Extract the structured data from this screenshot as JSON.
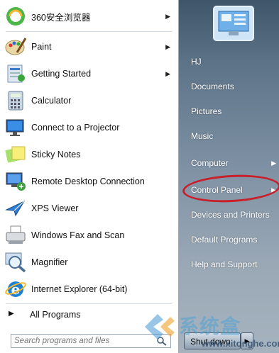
{
  "programs": [
    {
      "label": "360安全浏览器",
      "icon": "360-browser-icon",
      "has_arrow": true
    },
    {
      "label": "Paint",
      "icon": "paint-palette-icon",
      "has_arrow": true
    },
    {
      "label": "Getting Started",
      "icon": "getting-started-icon",
      "has_arrow": true
    },
    {
      "label": "Calculator",
      "icon": "calculator-icon",
      "has_arrow": false
    },
    {
      "label": "Connect to a Projector",
      "icon": "projector-icon",
      "has_arrow": false
    },
    {
      "label": "Sticky Notes",
      "icon": "sticky-notes-icon",
      "has_arrow": false
    },
    {
      "label": "Remote Desktop Connection",
      "icon": "remote-desktop-icon",
      "has_arrow": false
    },
    {
      "label": "XPS Viewer",
      "icon": "xps-viewer-icon",
      "has_arrow": false
    },
    {
      "label": "Windows Fax and Scan",
      "icon": "fax-scan-icon",
      "has_arrow": false
    },
    {
      "label": "Magnifier",
      "icon": "magnifier-icon",
      "has_arrow": false
    },
    {
      "label": "Internet Explorer (64-bit)",
      "icon": "internet-explorer-icon",
      "has_arrow": false
    }
  ],
  "all_programs": {
    "label": "All Programs"
  },
  "search": {
    "placeholder": "Search programs and files"
  },
  "right_items": [
    {
      "label": "HJ",
      "has_arrow": false
    },
    {
      "label": "Documents",
      "has_arrow": false
    },
    {
      "label": "Pictures",
      "has_arrow": false
    },
    {
      "label": "Music",
      "has_arrow": false
    },
    {
      "label": "Computer",
      "has_arrow": true
    },
    {
      "label": "Control Panel",
      "has_arrow": true
    },
    {
      "label": "Devices and Printers",
      "has_arrow": false
    },
    {
      "label": "Default Programs",
      "has_arrow": false
    },
    {
      "label": "Help and Support",
      "has_arrow": false
    }
  ],
  "shutdown": {
    "label": "Shut down"
  },
  "watermark": {
    "chinese": "系统盒",
    "url": "www.xitonghe.com"
  },
  "colors": {
    "highlight_circle": "#c8202a",
    "right_panel": "#6b7e91"
  }
}
